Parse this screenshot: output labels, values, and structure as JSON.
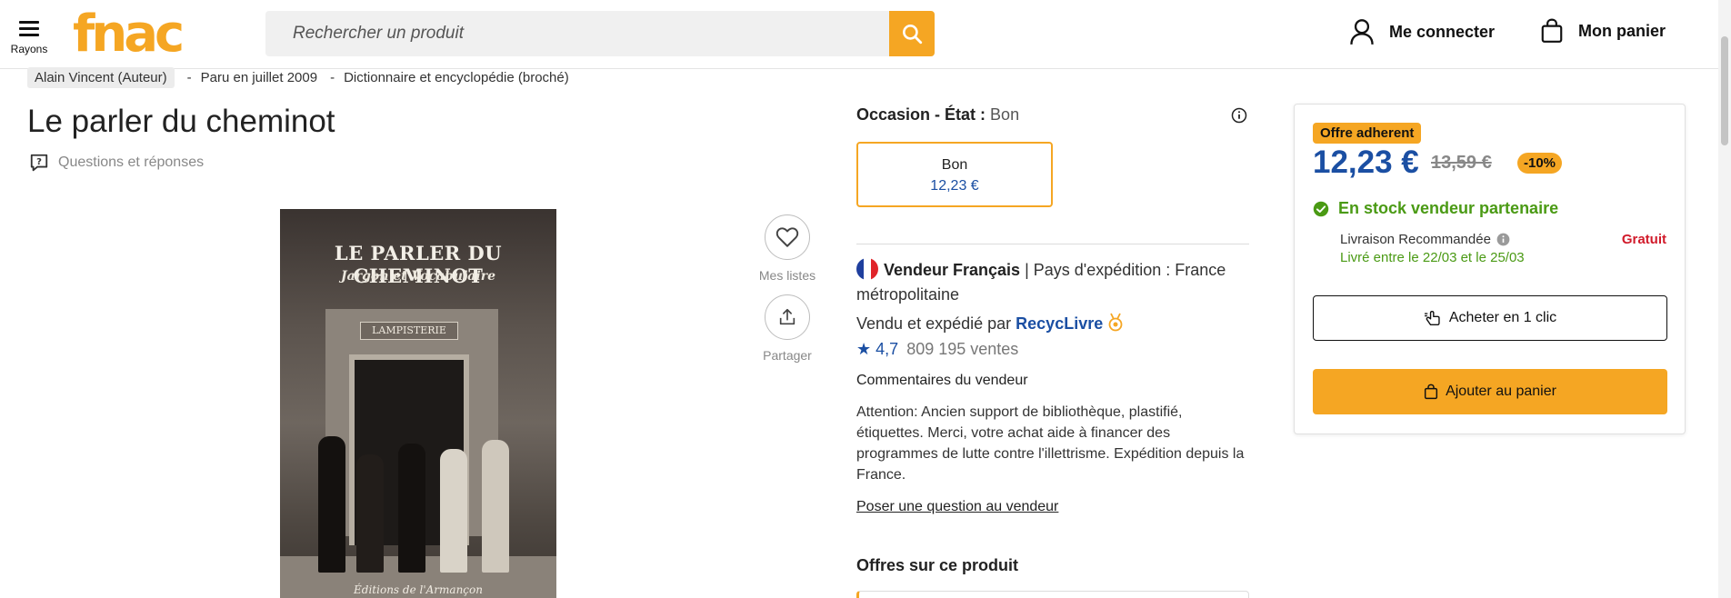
{
  "header": {
    "menu_label": "Rayons",
    "logo_text": "fnac",
    "search_placeholder": "Rechercher un produit",
    "login_label": "Me connecter",
    "cart_label": "Mon panier"
  },
  "product": {
    "author": "Alain Vincent (Auteur)",
    "published": "Paru en juillet 2009",
    "format": "Dictionnaire et encyclopédie (broché)",
    "separator": "-",
    "title": "Le parler du cheminot",
    "qa_label": "Questions et réponses",
    "cover": {
      "title": "LE PARLER DU CHEMINOT",
      "subtitle": "Jargon et Vocabulaire",
      "sign": "LAMPISTERIE",
      "publisher": "Éditions de l'Armançon"
    }
  },
  "actions": {
    "wishlist_label": "Mes listes",
    "share_label": "Partager"
  },
  "offer": {
    "condition_label": "Occasion - État :",
    "condition_value": "Bon",
    "card_label": "Bon",
    "card_price": "12,23 €",
    "seller_type": "Vendeur Français",
    "seller_ship": " | Pays d'expédition : France métropolitaine",
    "sold_by_prefix": "Vendu et expédié par",
    "seller_name": "RecycLivre",
    "rating": "4,7",
    "sales": "809 195 ventes",
    "comments_heading": "Commentaires du vendeur",
    "comments_text": "Attention: Ancien support de bibliothèque, plastifié, étiquettes. Merci, votre achat aide à financer des programmes de lutte contre l'illettrisme. Expédition depuis la France.",
    "ask_link": "Poser une question au vendeur",
    "offers_heading": "Offres sur ce produit"
  },
  "buybox": {
    "member_badge": "Offre adherent",
    "price": "12,23 €",
    "old_price": "13,59 €",
    "discount": "-10%",
    "stock": "En stock vendeur partenaire",
    "delivery_label": "Livraison Recommandée",
    "delivery_price": "Gratuit",
    "delivery_date": "Livré entre le 22/03 et le 25/03",
    "one_click_label": "Acheter en 1 clic",
    "add_cart_label": "Ajouter au panier"
  },
  "colors": {
    "brand": "#f5a623",
    "price_blue": "#1b4fa3",
    "stock_green": "#4a9a14",
    "free_red": "#d11a2a"
  },
  "icons": [
    "menu-icon",
    "search-icon",
    "user-icon",
    "bag-icon",
    "question-icon",
    "heart-icon",
    "share-icon",
    "info-icon",
    "flag-icon",
    "medal-icon",
    "star-icon",
    "check-icon",
    "hand-click-icon"
  ]
}
